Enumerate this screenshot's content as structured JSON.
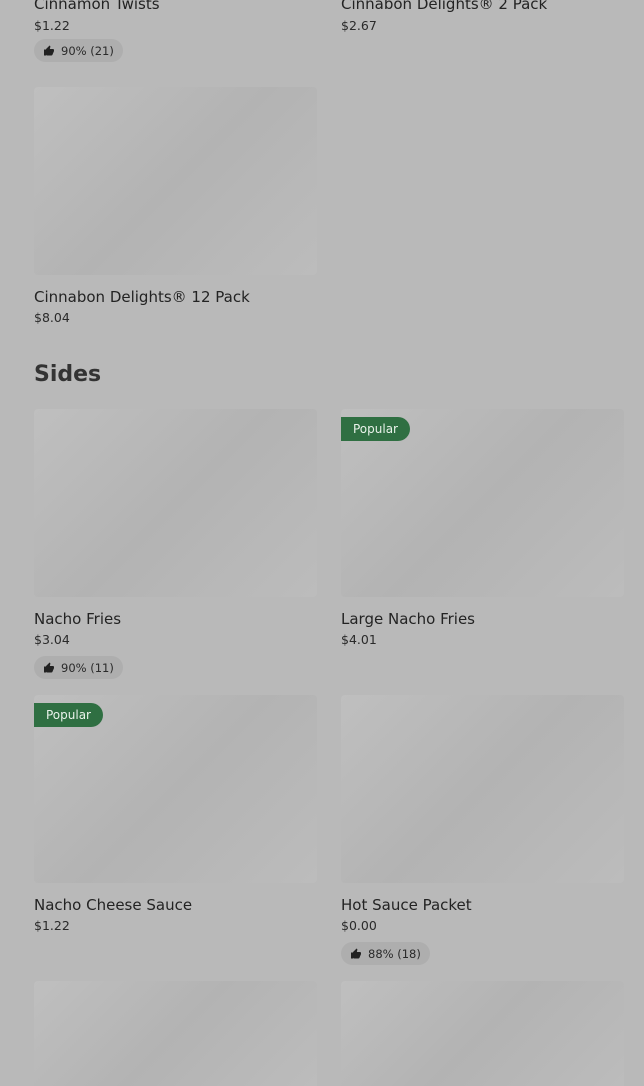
{
  "top_partial": [
    {
      "name": "Cinnamon Twists",
      "price": "$1.22",
      "rating": "90% (21)"
    },
    {
      "name": "Cinnabon Delights® 2 Pack",
      "price": "$2.67"
    }
  ],
  "cinnabon12": {
    "name": "Cinnabon Delights® 12 Pack",
    "price": "$8.04"
  },
  "sides": {
    "title": "Sides",
    "items": [
      {
        "name": "Nacho Fries",
        "price": "$3.04",
        "rating": "90% (11)"
      },
      {
        "name": "Large Nacho Fries",
        "price": "$4.01",
        "badge": "Popular"
      },
      {
        "name": "Nacho Cheese Sauce",
        "price": "$1.22",
        "badge": "Popular"
      },
      {
        "name": "Hot Sauce Packet",
        "price": "$0.00",
        "rating": "88% (18)"
      }
    ]
  },
  "colors": {
    "badge": "#2f6f42",
    "background": "#b9b9b9"
  }
}
